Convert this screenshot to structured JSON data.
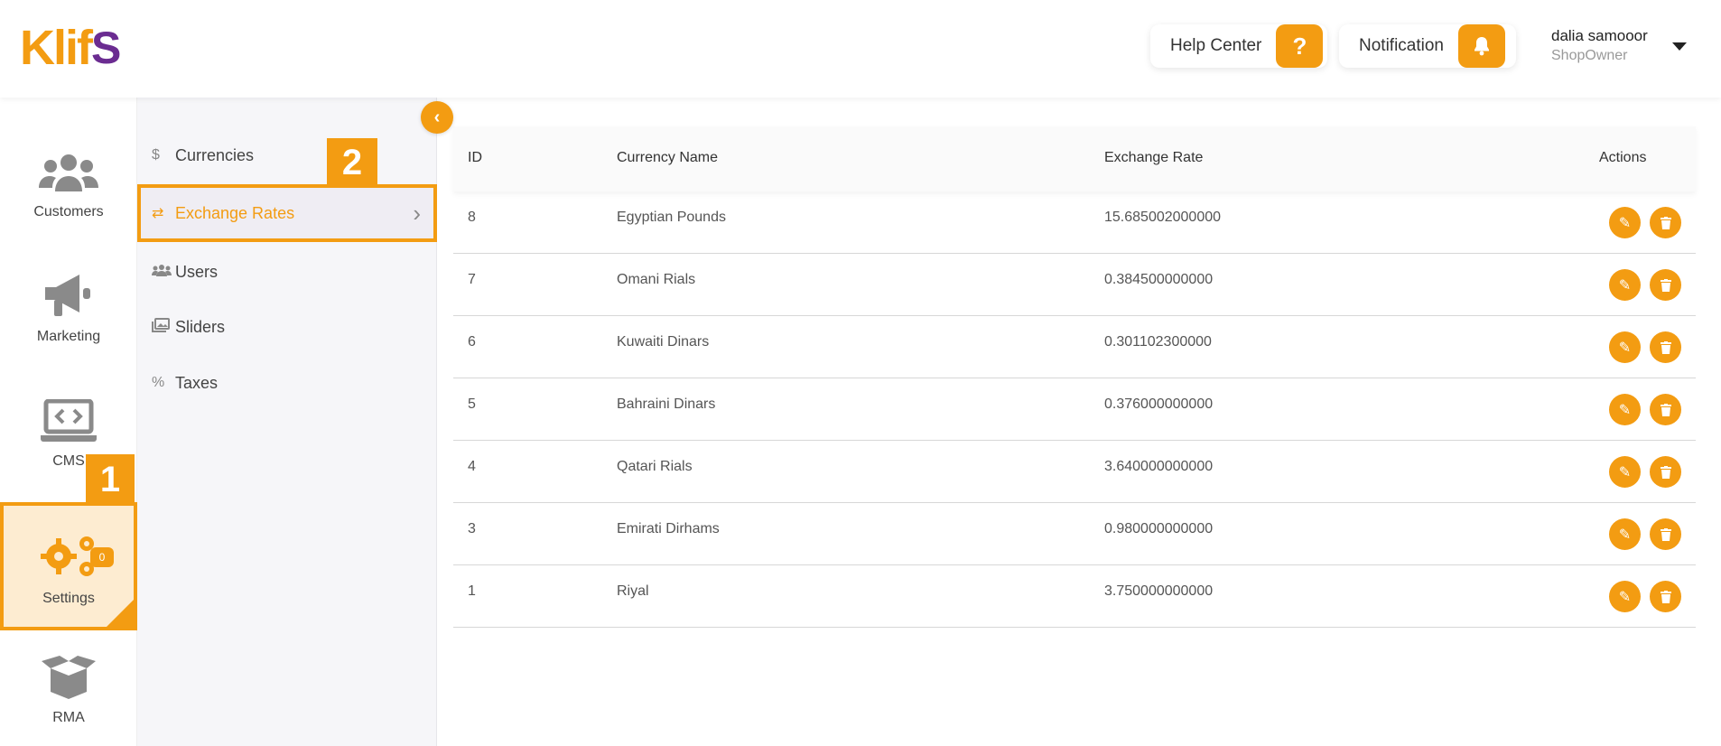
{
  "header": {
    "logo_part1": "Klif",
    "logo_part2": "S",
    "help_label": "Help Center",
    "help_icon": "question-icon",
    "notification_label": "Notification",
    "notification_icon": "bell-icon",
    "user_name": "dalia samooor",
    "user_role": "ShopOwner"
  },
  "rail": {
    "items": [
      {
        "label": "Customers",
        "icon": "users-icon"
      },
      {
        "label": "Marketing",
        "icon": "megaphone-icon"
      },
      {
        "label": "CMS",
        "icon": "code-laptop-icon"
      },
      {
        "label": "Settings",
        "icon": "gears-icon"
      },
      {
        "label": "RMA",
        "icon": "open-box-icon"
      }
    ],
    "rma_badge": "0",
    "marker_1": "1"
  },
  "submenu": {
    "items": [
      {
        "label": "Currencies",
        "icon": "dollar-icon"
      },
      {
        "label": "Exchange Rates",
        "icon": "exchange-icon"
      },
      {
        "label": "Users",
        "icon": "users-icon"
      },
      {
        "label": "Sliders",
        "icon": "images-icon"
      },
      {
        "label": "Taxes",
        "icon": "percent-icon"
      }
    ],
    "marker_2": "2"
  },
  "table": {
    "columns": [
      "ID",
      "Currency Name",
      "Exchange Rate",
      "Actions"
    ],
    "rows": [
      {
        "id": "8",
        "name": "Egyptian Pounds",
        "rate": "15.685002000000"
      },
      {
        "id": "7",
        "name": "Omani Rials",
        "rate": "0.384500000000"
      },
      {
        "id": "6",
        "name": "Kuwaiti Dinars",
        "rate": "0.301102300000"
      },
      {
        "id": "5",
        "name": "Bahraini Dinars",
        "rate": "0.376000000000"
      },
      {
        "id": "4",
        "name": "Qatari Rials",
        "rate": "3.640000000000"
      },
      {
        "id": "3",
        "name": "Emirati Dirhams",
        "rate": "0.980000000000"
      },
      {
        "id": "1",
        "name": "Riyal",
        "rate": "3.750000000000"
      }
    ]
  },
  "colors": {
    "accent": "#f39c12",
    "brand_secondary": "#6b2c91"
  }
}
